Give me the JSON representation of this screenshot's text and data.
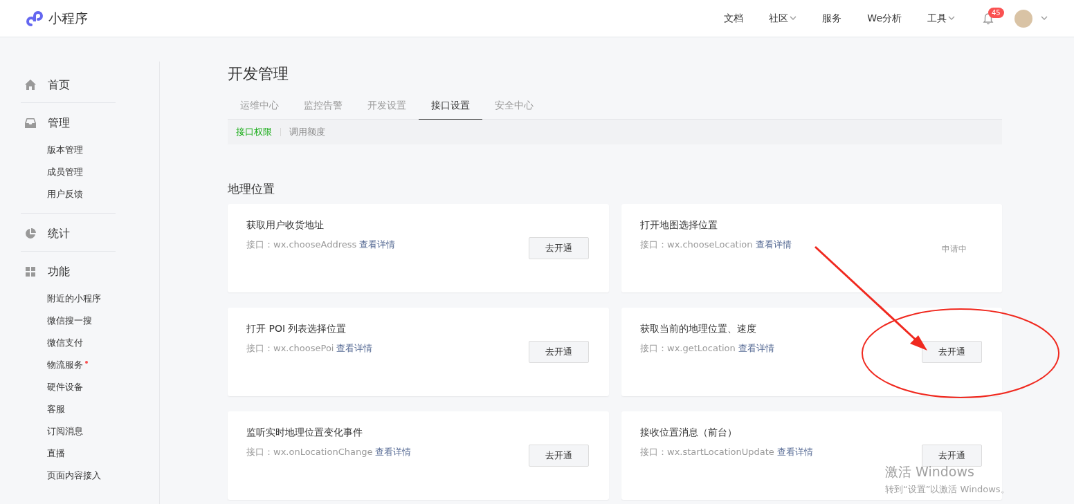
{
  "header": {
    "logo_text": "小程序",
    "nav": [
      {
        "label": "文档",
        "dropdown": false
      },
      {
        "label": "社区",
        "dropdown": true
      },
      {
        "label": "服务",
        "dropdown": false
      },
      {
        "label": "We分析",
        "dropdown": false
      },
      {
        "label": "工具",
        "dropdown": true
      }
    ],
    "notification_count": "45"
  },
  "sidebar": {
    "sections": [
      {
        "label": "首页",
        "kind": "home"
      },
      {
        "label": "管理",
        "kind": "inbox",
        "children": [
          {
            "label": "版本管理",
            "dot": false
          },
          {
            "label": "成员管理",
            "dot": false
          },
          {
            "label": "用户反馈",
            "dot": false
          }
        ]
      },
      {
        "label": "统计",
        "kind": "pie"
      },
      {
        "label": "功能",
        "kind": "grid",
        "children": [
          {
            "label": "附近的小程序",
            "dot": false
          },
          {
            "label": "微信搜一搜",
            "dot": false
          },
          {
            "label": "微信支付",
            "dot": false
          },
          {
            "label": "物流服务",
            "dot": true
          },
          {
            "label": "硬件设备",
            "dot": false
          },
          {
            "label": "客服",
            "dot": false
          },
          {
            "label": "订阅消息",
            "dot": false
          },
          {
            "label": "直播",
            "dot": false
          },
          {
            "label": "页面内容接入",
            "dot": false
          }
        ]
      }
    ]
  },
  "page": {
    "title": "开发管理",
    "tabs": [
      {
        "label": "运维中心",
        "selected": false
      },
      {
        "label": "监控告警",
        "selected": false
      },
      {
        "label": "开发设置",
        "selected": false
      },
      {
        "label": "接口设置",
        "selected": true
      },
      {
        "label": "安全中心",
        "selected": false
      }
    ],
    "subtabs": [
      {
        "label": "接口权限",
        "selected": true
      },
      {
        "label": "调用额度",
        "selected": false
      }
    ],
    "section_title": "地理位置",
    "cards": [
      {
        "title": "获取用户收货地址",
        "api": "接口：wx.chooseAddress",
        "link": "查看详情",
        "action": {
          "kind": "button",
          "label": "去开通"
        }
      },
      {
        "title": "打开地图选择位置",
        "api": "接口：wx.chooseLocation",
        "link": "查看详情",
        "action": {
          "kind": "status",
          "label": "申请中"
        }
      },
      {
        "title": "打开 POI 列表选择位置",
        "api": "接口：wx.choosePoi",
        "link": "查看详情",
        "action": {
          "kind": "button",
          "label": "去开通"
        }
      },
      {
        "title": "获取当前的地理位置、速度",
        "api": "接口：wx.getLocation",
        "link": "查看详情",
        "action": {
          "kind": "button",
          "label": "去开通"
        }
      },
      {
        "title": "监听实时地理位置变化事件",
        "api": "接口：wx.onLocationChange",
        "link": "查看详情",
        "action": {
          "kind": "button",
          "label": "去开通"
        }
      },
      {
        "title": "接收位置消息（前台）",
        "api": "接口：wx.startLocationUpdate",
        "link": "查看详情",
        "action": {
          "kind": "button",
          "label": "去开通"
        }
      }
    ]
  },
  "os_overlay": {
    "title": "激活 Windows",
    "subtitle": "转到“设置”以激活 Windows。"
  }
}
